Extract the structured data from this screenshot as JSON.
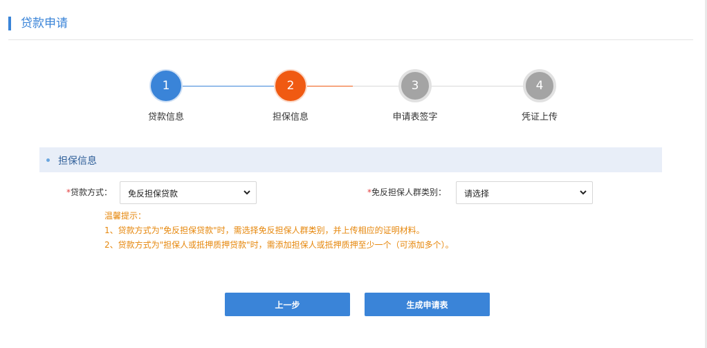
{
  "header": {
    "title": "贷款申请"
  },
  "steps": [
    {
      "number": "1",
      "label": "贷款信息",
      "state": "done"
    },
    {
      "number": "2",
      "label": "担保信息",
      "state": "active"
    },
    {
      "number": "3",
      "label": "申请表签字",
      "state": "pending"
    },
    {
      "number": "4",
      "label": "凭证上传",
      "state": "pending"
    }
  ],
  "section": {
    "title": "担保信息"
  },
  "form": {
    "required_mark": "*",
    "loan_method": {
      "label": "贷款方式：",
      "value": "免反担保贷款"
    },
    "guarantor_category": {
      "label": "免反担保人群类别：",
      "value": "请选择"
    }
  },
  "tips": {
    "title": "温馨提示：",
    "lines": [
      "1、贷款方式为\"免反担保贷款\"时，需选择免反担保人群类别，并上传相应的证明材料。",
      "2、贷款方式为\"担保人或抵押质押贷款\"时，需添加担保人或抵押质押至少一个（可添加多个）。"
    ]
  },
  "buttons": {
    "prev": "上一步",
    "generate": "生成申请表"
  },
  "colors": {
    "primary": "#3a84d8",
    "active_step": "#f05a12",
    "pending_step": "#a4a4a4",
    "tips": "#e6870c",
    "required": "#e23c3c"
  }
}
